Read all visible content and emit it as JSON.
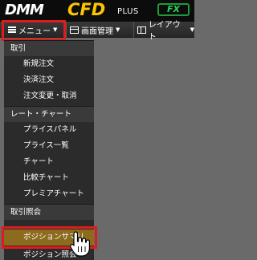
{
  "header": {
    "logo_dmm": "DMM",
    "logo_cfd": "CFD",
    "logo_plus": "PLUS",
    "badge": "FX"
  },
  "menubar": {
    "menu_label": "メニュー",
    "screen_label": "画面管理",
    "layout_label": "レイアウト"
  },
  "dropdown": {
    "sections": [
      {
        "label": "取引",
        "items": [
          "新規注文",
          "決済注文",
          "注文変更・取消"
        ]
      },
      {
        "label": "レート・チャート",
        "items": [
          "プライスパネル",
          "プライス一覧",
          "チャート",
          "比較チャート",
          "プレミアチャート"
        ]
      },
      {
        "label": "取引照会",
        "items": [
          "ポジションサマリ",
          "ポジション照会"
        ]
      }
    ],
    "selected_item": "ポジションサマリ"
  },
  "colors": {
    "highlight": "#e01b1b",
    "selected_bg": "#8c6b1f",
    "logo_cfd": "#ffc400",
    "fx_badge": "#2bd15a"
  }
}
